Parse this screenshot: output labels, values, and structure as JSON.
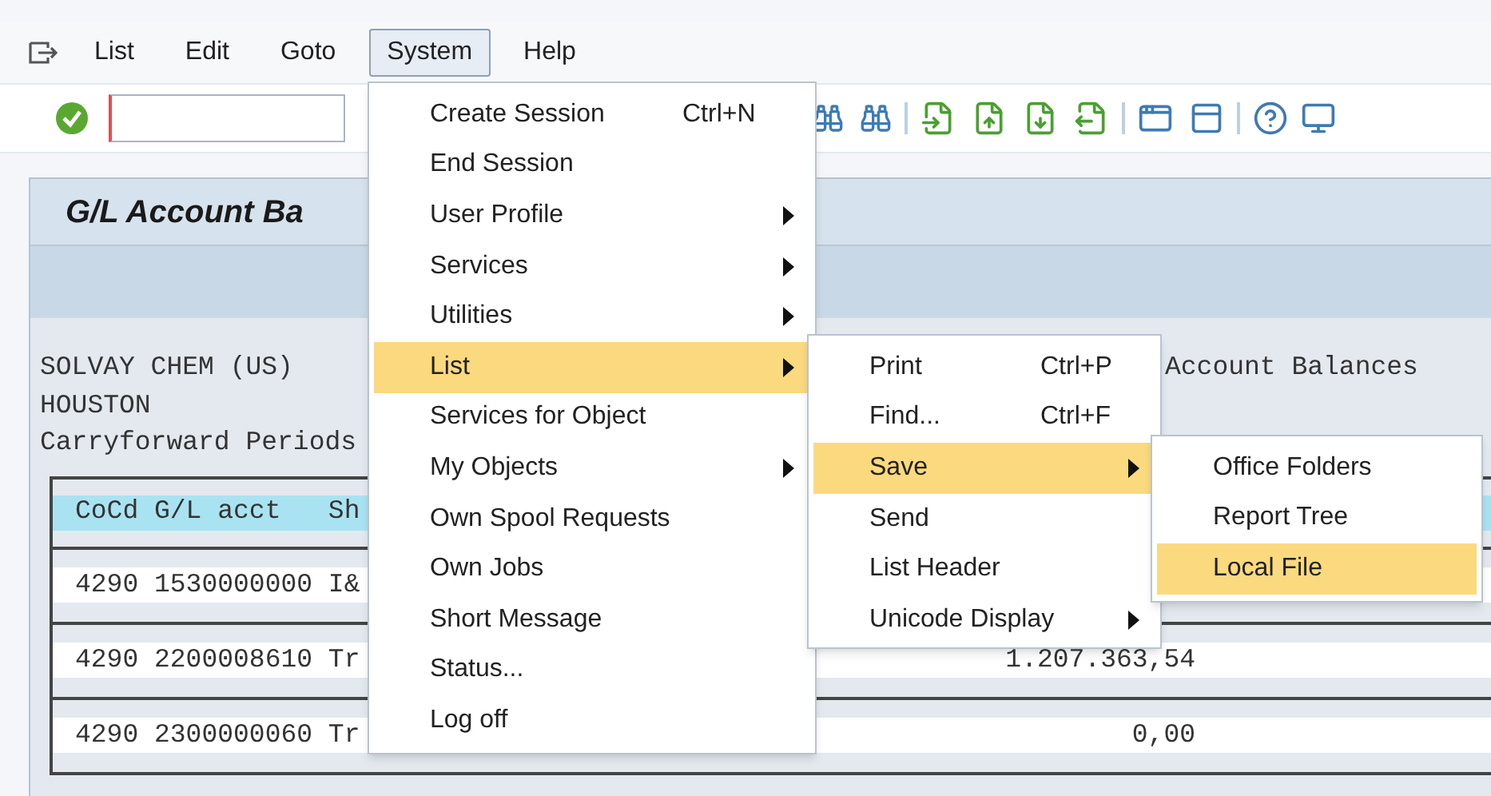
{
  "menu_bar": [
    {
      "label": "List",
      "selected": false
    },
    {
      "label": "Edit",
      "selected": false
    },
    {
      "label": "Goto",
      "selected": false
    },
    {
      "label": "System",
      "selected": true
    },
    {
      "label": "Help",
      "selected": false
    }
  ],
  "screen_title": "G/L Account Ba",
  "report": {
    "header_lines": [
      "SOLVAY CHEM (US)",
      "HOUSTON",
      "Carryforward Periods"
    ],
    "header_right": "Account Balances",
    "table_header": "CoCd G/L acct   Sh",
    "rows": [
      {
        "text": "4290 1530000000 I&"
      },
      {
        "text": "4290 2200008610 Tr",
        "amount": "1.207.363,54"
      },
      {
        "text": "4290 2300000060 Tr",
        "amount": "0,00"
      }
    ]
  },
  "menus": [
    {
      "items": [
        {
          "label": "Create Session",
          "shortcut": "Ctrl+N",
          "submenu": false,
          "selected": false
        },
        {
          "label": "End Session",
          "submenu": false,
          "selected": false
        },
        {
          "label": "User Profile",
          "submenu": true,
          "selected": false
        },
        {
          "label": "Services",
          "submenu": true,
          "selected": false
        },
        {
          "label": "Utilities",
          "submenu": true,
          "selected": false
        },
        {
          "label": "List",
          "submenu": true,
          "selected": true
        },
        {
          "label": "Services for Object",
          "submenu": false,
          "selected": false
        },
        {
          "label": "My Objects",
          "submenu": true,
          "selected": false
        },
        {
          "label": "Own Spool Requests",
          "submenu": false,
          "selected": false
        },
        {
          "label": "Own Jobs",
          "submenu": false,
          "selected": false
        },
        {
          "label": "Short Message",
          "submenu": false,
          "selected": false
        },
        {
          "label": "Status...",
          "submenu": false,
          "selected": false
        },
        {
          "label": "Log off",
          "submenu": false,
          "selected": false
        }
      ]
    },
    {
      "items": [
        {
          "label": "Print",
          "shortcut": "Ctrl+P",
          "submenu": false,
          "selected": false
        },
        {
          "label": "Find...",
          "shortcut": "Ctrl+F",
          "submenu": false,
          "selected": false
        },
        {
          "label": "Save",
          "submenu": true,
          "selected": true
        },
        {
          "label": "Send",
          "submenu": false,
          "selected": false
        },
        {
          "label": "List Header",
          "submenu": false,
          "selected": false
        },
        {
          "label": "Unicode Display",
          "submenu": true,
          "selected": false
        }
      ]
    },
    {
      "items": [
        {
          "label": "Office Folders",
          "submenu": false,
          "selected": false
        },
        {
          "label": "Report Tree",
          "submenu": false,
          "selected": false
        },
        {
          "label": "Local File",
          "submenu": false,
          "selected": true
        }
      ]
    }
  ]
}
